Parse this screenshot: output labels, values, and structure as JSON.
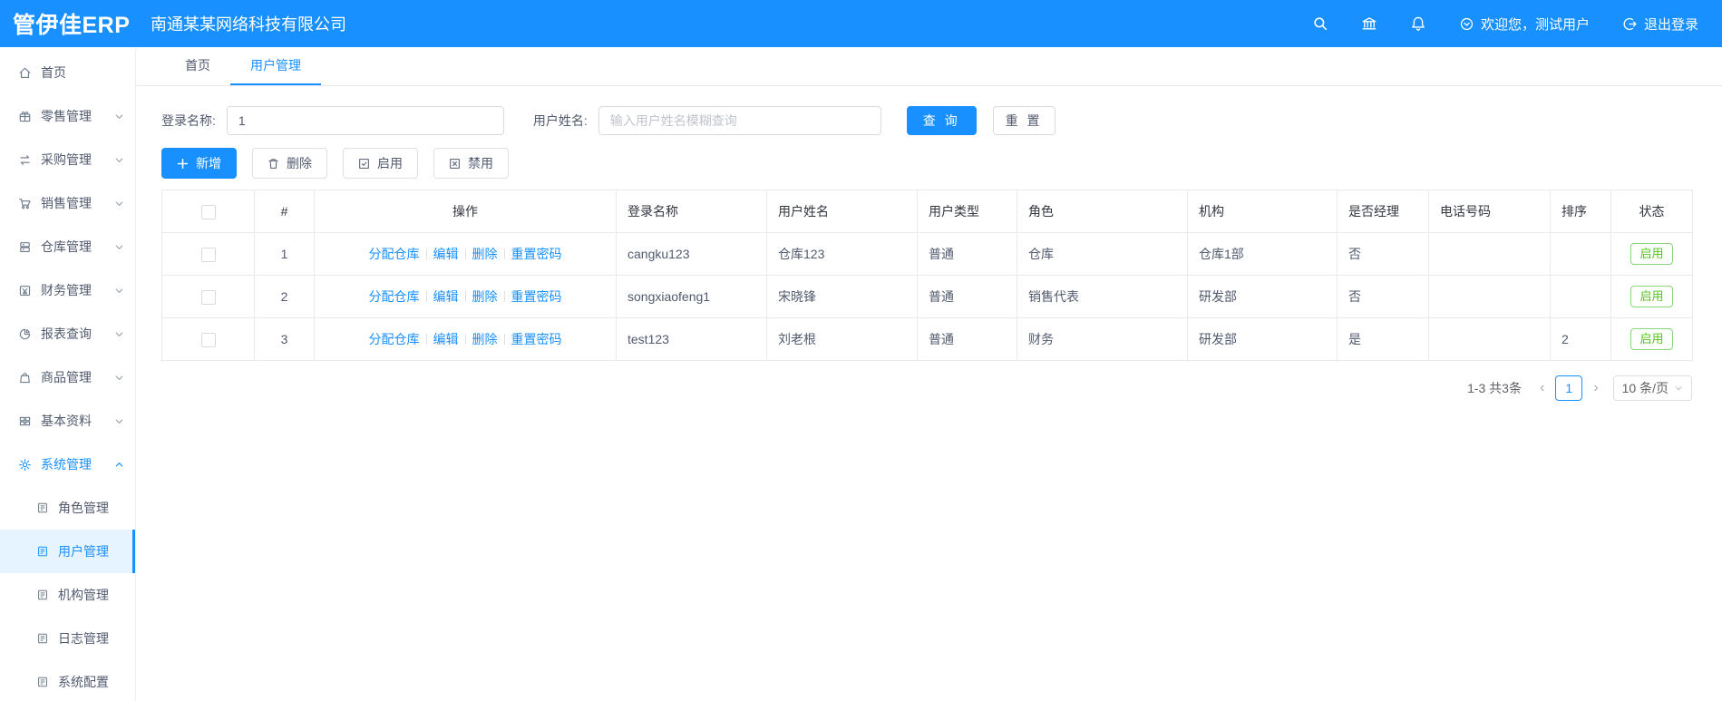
{
  "header": {
    "logo": "管伊佳ERP",
    "company": "南通某某网络科技有限公司",
    "welcome": "欢迎您，测试用户",
    "logout": "退出登录"
  },
  "sidebar": {
    "items": [
      {
        "label": "首页"
      },
      {
        "label": "零售管理"
      },
      {
        "label": "采购管理"
      },
      {
        "label": "销售管理"
      },
      {
        "label": "仓库管理"
      },
      {
        "label": "财务管理"
      },
      {
        "label": "报表查询"
      },
      {
        "label": "商品管理"
      },
      {
        "label": "基本资料"
      },
      {
        "label": "系统管理"
      }
    ],
    "submenu": [
      {
        "label": "角色管理"
      },
      {
        "label": "用户管理"
      },
      {
        "label": "机构管理"
      },
      {
        "label": "日志管理"
      },
      {
        "label": "系统配置"
      }
    ]
  },
  "tabs": [
    {
      "label": "首页"
    },
    {
      "label": "用户管理"
    }
  ],
  "filters": {
    "login_name_label": "登录名称:",
    "login_name_value": "1",
    "user_name_label": "用户姓名:",
    "user_name_placeholder": "输入用户姓名模糊查询",
    "search_button": "查 询",
    "reset_button": "重 置"
  },
  "toolbar": {
    "add": "新增",
    "delete": "删除",
    "enable": "启用",
    "disable": "禁用"
  },
  "table": {
    "columns": [
      "#",
      "操作",
      "登录名称",
      "用户姓名",
      "用户类型",
      "角色",
      "机构",
      "是否经理",
      "电话号码",
      "排序",
      "状态"
    ],
    "action_links": [
      "分配仓库",
      "编辑",
      "删除",
      "重置密码"
    ],
    "rows": [
      {
        "index": "1",
        "login": "cangku123",
        "name": "仓库123",
        "type": "普通",
        "role": "仓库",
        "org": "仓库1部",
        "manager": "否",
        "phone": "",
        "sort": "",
        "status": "启用"
      },
      {
        "index": "2",
        "login": "songxiaofeng1",
        "name": "宋晓锋",
        "type": "普通",
        "role": "销售代表",
        "org": "研发部",
        "manager": "否",
        "phone": "",
        "sort": "",
        "status": "启用"
      },
      {
        "index": "3",
        "login": "test123",
        "name": "刘老根",
        "type": "普通",
        "role": "财务",
        "org": "研发部",
        "manager": "是",
        "phone": "",
        "sort": "2",
        "status": "启用"
      }
    ]
  },
  "pagination": {
    "total": "1-3 共3条",
    "prev": "‹",
    "page": "1",
    "next": "›",
    "page_size": "10 条/页"
  },
  "colors": {
    "primary": "#1890ff",
    "success": "#52c41a",
    "active_bg": "#e6f4ff"
  }
}
